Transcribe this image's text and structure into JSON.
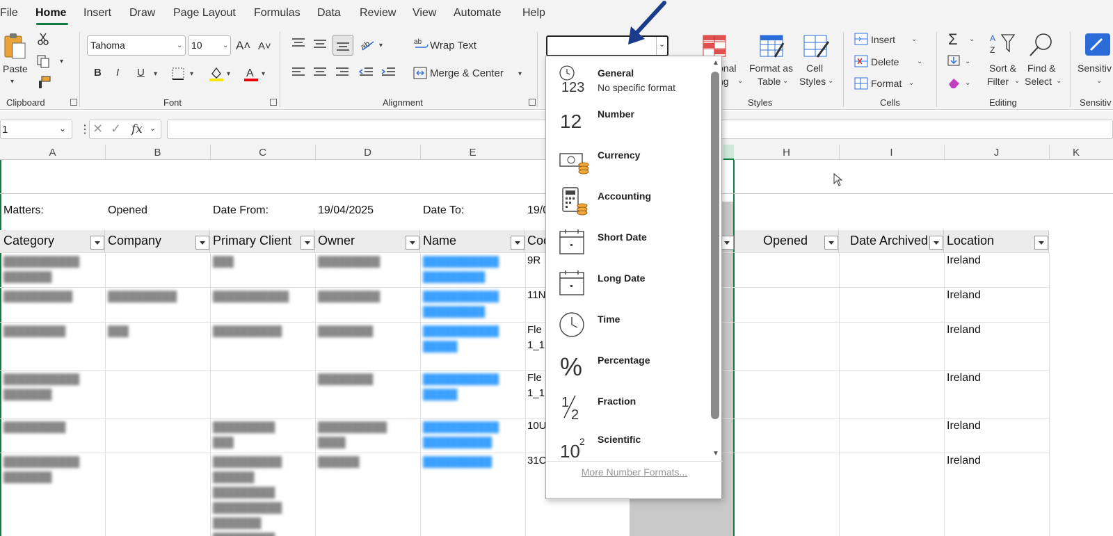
{
  "menu": {
    "tabs": [
      "File",
      "Home",
      "Insert",
      "Draw",
      "Page Layout",
      "Formulas",
      "Data",
      "Review",
      "View",
      "Automate",
      "Help"
    ],
    "active": "Home"
  },
  "ribbon": {
    "clipboard": {
      "paste": "Paste",
      "label": "Clipboard"
    },
    "font": {
      "family": "Tahoma",
      "size": "10",
      "label": "Font",
      "bold": "B",
      "italic": "I",
      "underline": "U"
    },
    "alignment": {
      "wrap_text": "Wrap Text",
      "merge_center": "Merge & Center",
      "label": "Alignment"
    },
    "number_format": {
      "value": ""
    },
    "styles": {
      "conditional": "onal",
      "conditional2": "ng",
      "format_as_table_1": "Format as",
      "format_as_table_2": "Table",
      "cell_styles_1": "Cell",
      "cell_styles_2": "Styles",
      "label": "Styles"
    },
    "cells": {
      "insert": "Insert",
      "delete": "Delete",
      "format": "Format",
      "label": "Cells"
    },
    "editing": {
      "sort_1": "Sort &",
      "sort_2": "Filter",
      "find_1": "Find &",
      "find_2": "Select",
      "label": "Editing"
    },
    "sensitivity": {
      "label_top": "Sensitiv",
      "label": "Sensitiv"
    }
  },
  "formula_bar": {
    "name_box": "1",
    "fx": "fx",
    "value": ""
  },
  "columns": [
    "A",
    "B",
    "C",
    "D",
    "E",
    "H",
    "I",
    "J",
    "K"
  ],
  "sheet": {
    "filter_row": {
      "matters_label": "Matters:",
      "matters_value": "Opened",
      "date_from_label": "Date From:",
      "date_from_value": "19/04/2025",
      "date_to_label": "Date To:",
      "date_to_value": "19/0"
    },
    "headers": [
      "Category",
      "Company",
      "Primary Client",
      "Owner",
      "Name",
      "Coo",
      "Opened",
      "Date Archived",
      "Location"
    ],
    "location_values": [
      "Ireland",
      "Ireland",
      "Ireland",
      "Ireland",
      "Ireland",
      "Ireland"
    ],
    "partial_cells": [
      "9R",
      "11N",
      "Fle",
      "1_1",
      "Fle",
      "1_1",
      "10U",
      "31C"
    ]
  },
  "number_dropdown": {
    "items": [
      {
        "title": "General",
        "subtitle": "No specific format",
        "icon": "general-clock-123-icon"
      },
      {
        "title": "Number",
        "subtitle": "",
        "icon": "number-12-icon"
      },
      {
        "title": "Currency",
        "subtitle": "",
        "icon": "currency-icon"
      },
      {
        "title": "Accounting",
        "subtitle": "",
        "icon": "accounting-calculator-icon"
      },
      {
        "title": "Short Date",
        "subtitle": "",
        "icon": "short-date-calendar-icon"
      },
      {
        "title": "Long Date",
        "subtitle": "",
        "icon": "long-date-calendar-icon"
      },
      {
        "title": "Time",
        "subtitle": "",
        "icon": "time-clock-icon"
      },
      {
        "title": "Percentage",
        "subtitle": "",
        "icon": "percent-icon"
      },
      {
        "title": "Fraction",
        "subtitle": "",
        "icon": "fraction-icon"
      },
      {
        "title": "Scientific",
        "subtitle": "",
        "icon": "scientific-icon"
      }
    ],
    "more": "More Number Formats...",
    "icon_text": {
      "general": "123",
      "number": "12",
      "percent": "%",
      "fraction_num": "1",
      "fraction_den": "2",
      "sci_base": "10",
      "sci_exp": "2"
    }
  },
  "colors": {
    "accent": "#107c41",
    "arrow": "#1a3a8a",
    "link": "#3aa0ff"
  }
}
